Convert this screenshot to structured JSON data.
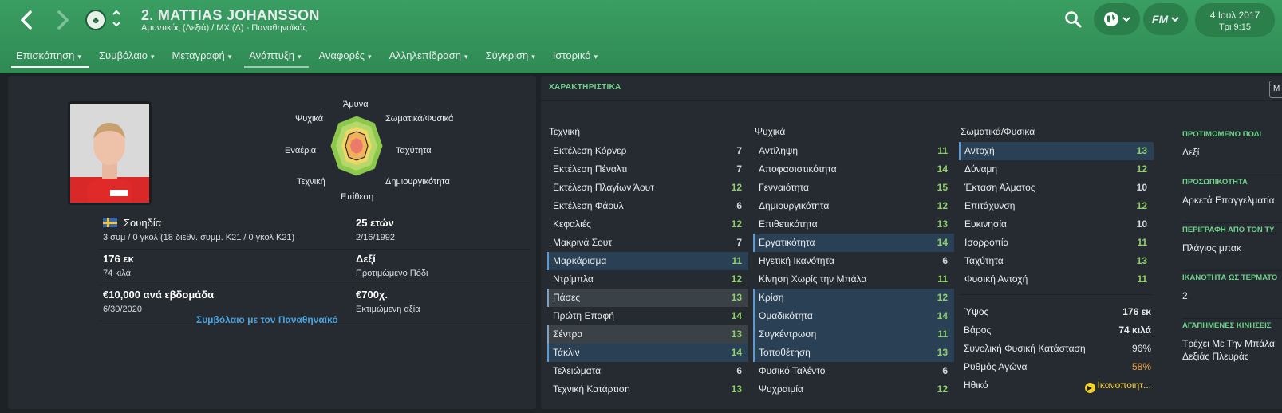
{
  "header": {
    "player_title": "2. MATTIAS JOHANSSON",
    "player_subtitle": "Αμυντικός (Δεξιά) / ΜΧ (Δ) - Παναθηναϊκός",
    "back_icon": "chevron-left-icon",
    "forward_icon": "chevron-right-icon",
    "fm_label": "FM",
    "date": "4 Ιουλ 2017",
    "time": "Τρι 9:15"
  },
  "tabs": [
    {
      "label": "Επισκόπηση"
    },
    {
      "label": "Συμβόλαιο"
    },
    {
      "label": "Μεταγραφή"
    },
    {
      "label": "Ανάπτυξη"
    },
    {
      "label": "Αναφορές"
    },
    {
      "label": "Αλληλεπίδραση"
    },
    {
      "label": "Σύγκριση"
    },
    {
      "label": "Ιστορικό"
    }
  ],
  "radar": {
    "labels": {
      "defence": "Άμυνα",
      "physical": "Σωματικά/Φυσικά",
      "speed": "Ταχύτητα",
      "creativity": "Δημιουργικότητα",
      "attack": "Επίθεση",
      "technique": "Τεχνική",
      "aerial": "Εναέρια",
      "mental": "Ψυχικά"
    }
  },
  "profile": {
    "nationality": "Σουηδία",
    "caps": "3 συμ / 0 γκολ (18 διεθν. συμμ. Κ21 / 0 γκολ Κ21)",
    "age": "25 ετών",
    "dob": "2/16/1992",
    "height": "176 εκ",
    "weight": "74 κιλά",
    "preferred_foot": "Δεξί",
    "preferred_foot_label": "Προτιμώμενο Πόδι",
    "wage": "€10,000 ανά εβδομάδα",
    "contract_end": "6/30/2020",
    "value": "€700χ.",
    "value_label": "Εκτιμώμενη αξία",
    "contract_link": "Συμβόλαιο με τον Παναθηναϊκό"
  },
  "attributes": {
    "section_title": "ΧΑΡΑΚΤΗΡΙΣΤΙΚΑ",
    "corner_button": "Μ",
    "technical": {
      "header": "Τεχνική",
      "items": [
        {
          "name": "Εκτέλεση Κόρνερ",
          "value": "7"
        },
        {
          "name": "Εκτέλεση Πέναλτι",
          "value": "7"
        },
        {
          "name": "Εκτέλεση Πλαγίων Άουτ",
          "value": "12"
        },
        {
          "name": "Εκτέλεση Φάουλ",
          "value": "6"
        },
        {
          "name": "Κεφαλιές",
          "value": "12"
        },
        {
          "name": "Μακρινά Σουτ",
          "value": "7"
        },
        {
          "name": "Μαρκάρισμα",
          "value": "11"
        },
        {
          "name": "Ντρίμπλα",
          "value": "12"
        },
        {
          "name": "Πάσες",
          "value": "13"
        },
        {
          "name": "Πρώτη Επαφή",
          "value": "14"
        },
        {
          "name": "Σέντρα",
          "value": "13"
        },
        {
          "name": "Τάκλιν",
          "value": "14"
        },
        {
          "name": "Τελειώματα",
          "value": "6"
        },
        {
          "name": "Τεχνική Κατάρτιση",
          "value": "13"
        }
      ]
    },
    "mental": {
      "header": "Ψυχικά",
      "items": [
        {
          "name": "Αντίληψη",
          "value": "11"
        },
        {
          "name": "Αποφασιστικότητα",
          "value": "14"
        },
        {
          "name": "Γενναιότητα",
          "value": "15"
        },
        {
          "name": "Δημιουργικότητα",
          "value": "12"
        },
        {
          "name": "Επιθετικότητα",
          "value": "13"
        },
        {
          "name": "Εργατικότητα",
          "value": "14"
        },
        {
          "name": "Ηγετική Ικανότητα",
          "value": "6"
        },
        {
          "name": "Κίνηση Χωρίς την Μπάλα",
          "value": "11"
        },
        {
          "name": "Κρίση",
          "value": "12"
        },
        {
          "name": "Ομαδικότητα",
          "value": "14"
        },
        {
          "name": "Συγκέντρωση",
          "value": "11"
        },
        {
          "name": "Τοποθέτηση",
          "value": "13"
        },
        {
          "name": "Φυσικό Ταλέντο",
          "value": "6"
        },
        {
          "name": "Ψυχραιμία",
          "value": "12"
        }
      ]
    },
    "physical": {
      "header": "Σωματικά/Φυσικά",
      "items": [
        {
          "name": "Αντοχή",
          "value": "13"
        },
        {
          "name": "Δύναμη",
          "value": "12"
        },
        {
          "name": "Έκταση Άλματος",
          "value": "10"
        },
        {
          "name": "Επιτάχυνση",
          "value": "12"
        },
        {
          "name": "Ευκινησία",
          "value": "10"
        },
        {
          "name": "Ισορροπία",
          "value": "11"
        },
        {
          "name": "Ταχύτητα",
          "value": "13"
        },
        {
          "name": "Φυσική Αντοχή",
          "value": "11"
        }
      ]
    },
    "physical_stats": {
      "height_label": "Ύψος",
      "height": "176 εκ",
      "weight_label": "Βάρος",
      "weight": "74 κιλά",
      "condition_label": "Συνολική Φυσική Κατάσταση",
      "condition": "96%",
      "match_fitness_label": "Ρυθμός Αγώνα",
      "match_fitness": "58%",
      "morale_label": "Ηθικό",
      "morale": "Ικανοποιητ..."
    }
  },
  "side_info": {
    "foot_header": "ΠΡΟΤΙΜΩΜΕΝΟ ΠΟΔΙ",
    "foot": "Δεξί",
    "personality_header": "ΠΡΟΣΩΠΙΚΟΤΗΤΑ",
    "personality": "Αρκετά Επαγγελματία",
    "role_header": "ΠΕΡΙΓΡΑΦΗ ΑΠΟ ΤΟΝ ΤΥ",
    "role": "Πλάγιος μπακ",
    "ability_header": "ΙΚΑΝΟΤΗΤΑ ΩΣ ΤΕΡΜΑΤΟ",
    "ability": "2",
    "moves_header": "ΑΓΑΠΗΜΕΝΕΣ ΚΙΝΗΣΕΙΣ",
    "moves_1": "Τρέχει Με Την Μπάλα",
    "moves_2": "Δεξιάς Πλευράς"
  }
}
